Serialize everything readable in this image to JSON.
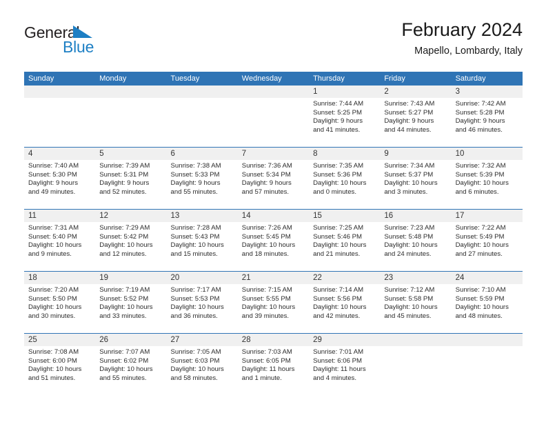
{
  "brand": {
    "name_part1": "General",
    "name_part2": "Blue",
    "mark": "triangle-logo-icon",
    "color_dark": "#231f20",
    "color_blue": "#1d7fc4"
  },
  "header": {
    "title": "February 2024",
    "subtitle": "Mapello, Lombardy, Italy"
  },
  "theme": {
    "header_blue": "#2f74b5",
    "date_band_gray": "#f0f0f0",
    "cell_white": "#ffffff",
    "text_dark": "#2b2b2b"
  },
  "weekdays": [
    "Sunday",
    "Monday",
    "Tuesday",
    "Wednesday",
    "Thursday",
    "Friday",
    "Saturday"
  ],
  "weeks": [
    [
      {
        "day": "",
        "sunrise": "",
        "sunset": "",
        "daylight_line1": "",
        "daylight_line2": ""
      },
      {
        "day": "",
        "sunrise": "",
        "sunset": "",
        "daylight_line1": "",
        "daylight_line2": ""
      },
      {
        "day": "",
        "sunrise": "",
        "sunset": "",
        "daylight_line1": "",
        "daylight_line2": ""
      },
      {
        "day": "",
        "sunrise": "",
        "sunset": "",
        "daylight_line1": "",
        "daylight_line2": ""
      },
      {
        "day": "1",
        "sunrise": "Sunrise: 7:44 AM",
        "sunset": "Sunset: 5:25 PM",
        "daylight_line1": "Daylight: 9 hours",
        "daylight_line2": "and 41 minutes."
      },
      {
        "day": "2",
        "sunrise": "Sunrise: 7:43 AM",
        "sunset": "Sunset: 5:27 PM",
        "daylight_line1": "Daylight: 9 hours",
        "daylight_line2": "and 44 minutes."
      },
      {
        "day": "3",
        "sunrise": "Sunrise: 7:42 AM",
        "sunset": "Sunset: 5:28 PM",
        "daylight_line1": "Daylight: 9 hours",
        "daylight_line2": "and 46 minutes."
      }
    ],
    [
      {
        "day": "4",
        "sunrise": "Sunrise: 7:40 AM",
        "sunset": "Sunset: 5:30 PM",
        "daylight_line1": "Daylight: 9 hours",
        "daylight_line2": "and 49 minutes."
      },
      {
        "day": "5",
        "sunrise": "Sunrise: 7:39 AM",
        "sunset": "Sunset: 5:31 PM",
        "daylight_line1": "Daylight: 9 hours",
        "daylight_line2": "and 52 minutes."
      },
      {
        "day": "6",
        "sunrise": "Sunrise: 7:38 AM",
        "sunset": "Sunset: 5:33 PM",
        "daylight_line1": "Daylight: 9 hours",
        "daylight_line2": "and 55 minutes."
      },
      {
        "day": "7",
        "sunrise": "Sunrise: 7:36 AM",
        "sunset": "Sunset: 5:34 PM",
        "daylight_line1": "Daylight: 9 hours",
        "daylight_line2": "and 57 minutes."
      },
      {
        "day": "8",
        "sunrise": "Sunrise: 7:35 AM",
        "sunset": "Sunset: 5:36 PM",
        "daylight_line1": "Daylight: 10 hours",
        "daylight_line2": "and 0 minutes."
      },
      {
        "day": "9",
        "sunrise": "Sunrise: 7:34 AM",
        "sunset": "Sunset: 5:37 PM",
        "daylight_line1": "Daylight: 10 hours",
        "daylight_line2": "and 3 minutes."
      },
      {
        "day": "10",
        "sunrise": "Sunrise: 7:32 AM",
        "sunset": "Sunset: 5:39 PM",
        "daylight_line1": "Daylight: 10 hours",
        "daylight_line2": "and 6 minutes."
      }
    ],
    [
      {
        "day": "11",
        "sunrise": "Sunrise: 7:31 AM",
        "sunset": "Sunset: 5:40 PM",
        "daylight_line1": "Daylight: 10 hours",
        "daylight_line2": "and 9 minutes."
      },
      {
        "day": "12",
        "sunrise": "Sunrise: 7:29 AM",
        "sunset": "Sunset: 5:42 PM",
        "daylight_line1": "Daylight: 10 hours",
        "daylight_line2": "and 12 minutes."
      },
      {
        "day": "13",
        "sunrise": "Sunrise: 7:28 AM",
        "sunset": "Sunset: 5:43 PM",
        "daylight_line1": "Daylight: 10 hours",
        "daylight_line2": "and 15 minutes."
      },
      {
        "day": "14",
        "sunrise": "Sunrise: 7:26 AM",
        "sunset": "Sunset: 5:45 PM",
        "daylight_line1": "Daylight: 10 hours",
        "daylight_line2": "and 18 minutes."
      },
      {
        "day": "15",
        "sunrise": "Sunrise: 7:25 AM",
        "sunset": "Sunset: 5:46 PM",
        "daylight_line1": "Daylight: 10 hours",
        "daylight_line2": "and 21 minutes."
      },
      {
        "day": "16",
        "sunrise": "Sunrise: 7:23 AM",
        "sunset": "Sunset: 5:48 PM",
        "daylight_line1": "Daylight: 10 hours",
        "daylight_line2": "and 24 minutes."
      },
      {
        "day": "17",
        "sunrise": "Sunrise: 7:22 AM",
        "sunset": "Sunset: 5:49 PM",
        "daylight_line1": "Daylight: 10 hours",
        "daylight_line2": "and 27 minutes."
      }
    ],
    [
      {
        "day": "18",
        "sunrise": "Sunrise: 7:20 AM",
        "sunset": "Sunset: 5:50 PM",
        "daylight_line1": "Daylight: 10 hours",
        "daylight_line2": "and 30 minutes."
      },
      {
        "day": "19",
        "sunrise": "Sunrise: 7:19 AM",
        "sunset": "Sunset: 5:52 PM",
        "daylight_line1": "Daylight: 10 hours",
        "daylight_line2": "and 33 minutes."
      },
      {
        "day": "20",
        "sunrise": "Sunrise: 7:17 AM",
        "sunset": "Sunset: 5:53 PM",
        "daylight_line1": "Daylight: 10 hours",
        "daylight_line2": "and 36 minutes."
      },
      {
        "day": "21",
        "sunrise": "Sunrise: 7:15 AM",
        "sunset": "Sunset: 5:55 PM",
        "daylight_line1": "Daylight: 10 hours",
        "daylight_line2": "and 39 minutes."
      },
      {
        "day": "22",
        "sunrise": "Sunrise: 7:14 AM",
        "sunset": "Sunset: 5:56 PM",
        "daylight_line1": "Daylight: 10 hours",
        "daylight_line2": "and 42 minutes."
      },
      {
        "day": "23",
        "sunrise": "Sunrise: 7:12 AM",
        "sunset": "Sunset: 5:58 PM",
        "daylight_line1": "Daylight: 10 hours",
        "daylight_line2": "and 45 minutes."
      },
      {
        "day": "24",
        "sunrise": "Sunrise: 7:10 AM",
        "sunset": "Sunset: 5:59 PM",
        "daylight_line1": "Daylight: 10 hours",
        "daylight_line2": "and 48 minutes."
      }
    ],
    [
      {
        "day": "25",
        "sunrise": "Sunrise: 7:08 AM",
        "sunset": "Sunset: 6:00 PM",
        "daylight_line1": "Daylight: 10 hours",
        "daylight_line2": "and 51 minutes."
      },
      {
        "day": "26",
        "sunrise": "Sunrise: 7:07 AM",
        "sunset": "Sunset: 6:02 PM",
        "daylight_line1": "Daylight: 10 hours",
        "daylight_line2": "and 55 minutes."
      },
      {
        "day": "27",
        "sunrise": "Sunrise: 7:05 AM",
        "sunset": "Sunset: 6:03 PM",
        "daylight_line1": "Daylight: 10 hours",
        "daylight_line2": "and 58 minutes."
      },
      {
        "day": "28",
        "sunrise": "Sunrise: 7:03 AM",
        "sunset": "Sunset: 6:05 PM",
        "daylight_line1": "Daylight: 11 hours",
        "daylight_line2": "and 1 minute."
      },
      {
        "day": "29",
        "sunrise": "Sunrise: 7:01 AM",
        "sunset": "Sunset: 6:06 PM",
        "daylight_line1": "Daylight: 11 hours",
        "daylight_line2": "and 4 minutes."
      },
      {
        "day": "",
        "sunrise": "",
        "sunset": "",
        "daylight_line1": "",
        "daylight_line2": ""
      },
      {
        "day": "",
        "sunrise": "",
        "sunset": "",
        "daylight_line1": "",
        "daylight_line2": ""
      }
    ]
  ]
}
